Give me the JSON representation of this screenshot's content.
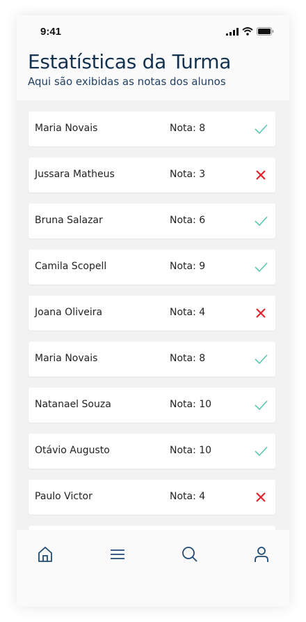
{
  "status_bar": {
    "time": "9:41"
  },
  "header": {
    "title": "Estatísticas da Turma",
    "subtitle": "Aqui são exibidas as notas dos alunos"
  },
  "students": [
    {
      "name": "Maria Novais",
      "grade": "Nota: 8",
      "status": "check-icon"
    },
    {
      "name": "Jussara Matheus",
      "grade": "Nota: 3",
      "status": "cross-icon"
    },
    {
      "name": "Bruna Salazar",
      "grade": "Nota: 6",
      "status": "check-icon"
    },
    {
      "name": "Camila Scopell",
      "grade": "Nota: 9",
      "status": "check-icon"
    },
    {
      "name": "Joana Oliveira",
      "grade": "Nota: 4",
      "status": "cross-icon"
    },
    {
      "name": "Maria Novais",
      "grade": "Nota: 8",
      "status": "check-icon"
    },
    {
      "name": "Natanael Souza",
      "grade": "Nota: 10",
      "status": "check-icon"
    },
    {
      "name": "Otávio Augusto",
      "grade": "Nota: 10",
      "status": "check-icon"
    },
    {
      "name": "Paulo Victor",
      "grade": "Nota: 4",
      "status": "cross-icon"
    }
  ],
  "tabbar": {
    "items": [
      "home-icon",
      "menu-icon",
      "search-icon",
      "profile-icon"
    ]
  },
  "colors": {
    "title": "#13324f",
    "check": "#5cc7b2",
    "cross": "#e0242b",
    "icon": "#1f4a73"
  }
}
